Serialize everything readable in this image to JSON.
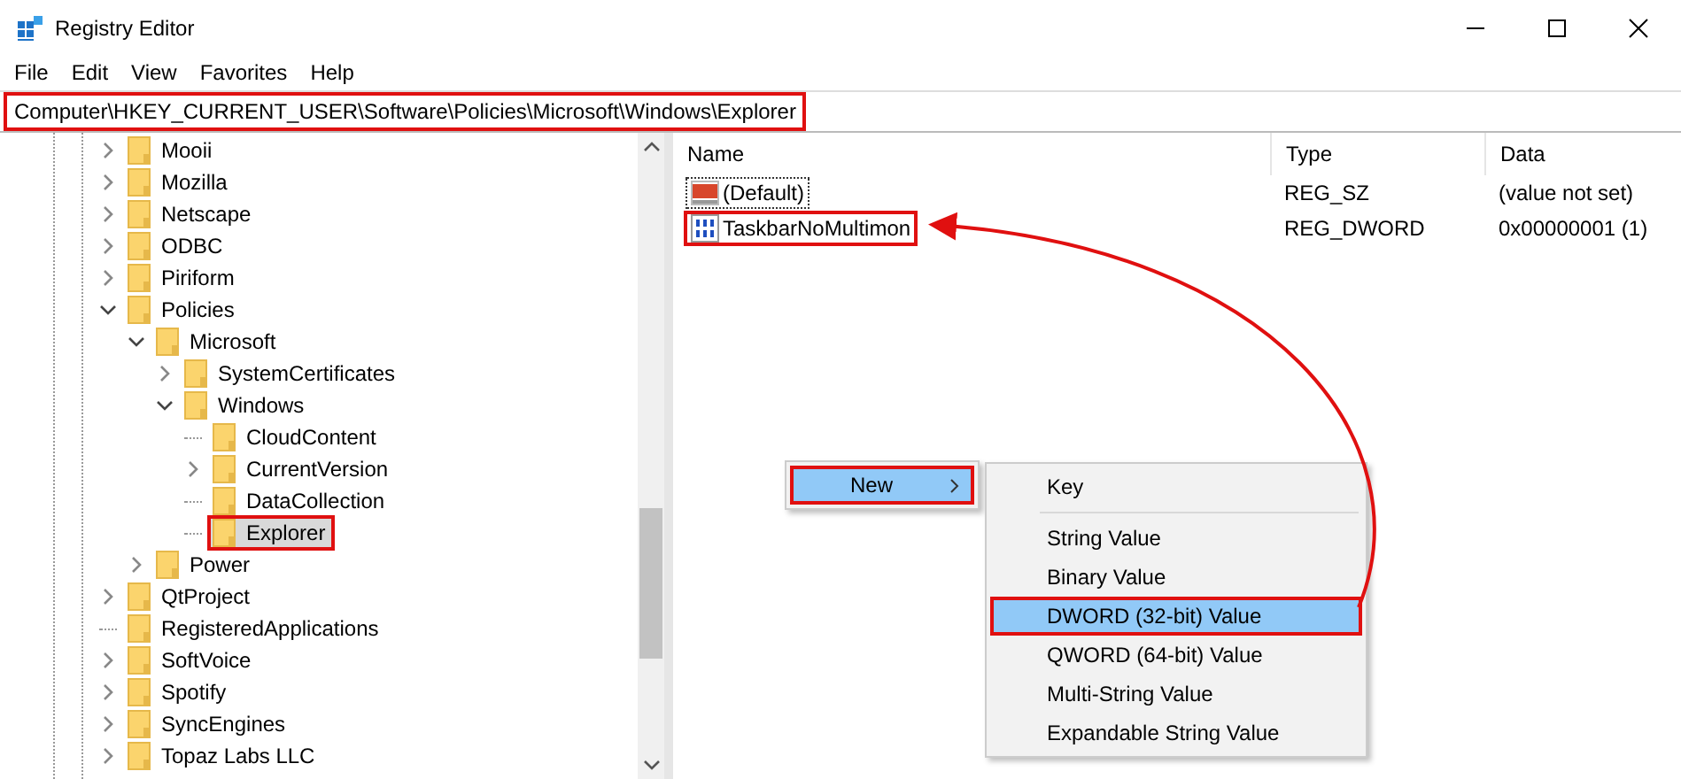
{
  "window": {
    "title": "Registry Editor"
  },
  "menu": [
    "File",
    "Edit",
    "View",
    "Favorites",
    "Help"
  ],
  "address_bar": {
    "value": "Computer\\HKEY_CURRENT_USER\\Software\\Policies\\Microsoft\\Windows\\Explorer",
    "highlighted": true
  },
  "tree": [
    {
      "label": "Mooii",
      "kind": "collapsed",
      "selected": false,
      "highlighted": false
    },
    {
      "label": "Mozilla",
      "kind": "collapsed",
      "selected": false,
      "highlighted": false
    },
    {
      "label": "Netscape",
      "kind": "collapsed",
      "selected": false,
      "highlighted": false
    },
    {
      "label": "ODBC",
      "kind": "collapsed",
      "selected": false,
      "highlighted": false
    },
    {
      "label": "Piriform",
      "kind": "collapsed",
      "selected": false,
      "highlighted": false
    },
    {
      "label": "Policies",
      "kind": "expanded",
      "selected": false,
      "highlighted": false,
      "children": [
        {
          "label": "Microsoft",
          "kind": "expanded",
          "selected": false,
          "highlighted": false,
          "children": [
            {
              "label": "SystemCertificates",
              "kind": "collapsed",
              "selected": false,
              "highlighted": false
            },
            {
              "label": "Windows",
              "kind": "expanded",
              "selected": false,
              "highlighted": false,
              "children": [
                {
                  "label": "CloudContent",
                  "kind": "leaf",
                  "selected": false,
                  "highlighted": false
                },
                {
                  "label": "CurrentVersion",
                  "kind": "collapsed",
                  "selected": false,
                  "highlighted": false
                },
                {
                  "label": "DataCollection",
                  "kind": "leaf",
                  "selected": false,
                  "highlighted": false
                },
                {
                  "label": "Explorer",
                  "kind": "leaf",
                  "selected": true,
                  "highlighted": true
                }
              ]
            }
          ]
        },
        {
          "label": "Power",
          "kind": "collapsed",
          "selected": false,
          "highlighted": false
        }
      ]
    },
    {
      "label": "QtProject",
      "kind": "collapsed",
      "selected": false,
      "highlighted": false
    },
    {
      "label": "RegisteredApplications",
      "kind": "leaf",
      "selected": false,
      "highlighted": false
    },
    {
      "label": "SoftVoice",
      "kind": "collapsed",
      "selected": false,
      "highlighted": false
    },
    {
      "label": "Spotify",
      "kind": "collapsed",
      "selected": false,
      "highlighted": false
    },
    {
      "label": "SyncEngines",
      "kind": "collapsed",
      "selected": false,
      "highlighted": false
    },
    {
      "label": "Topaz Labs LLC",
      "kind": "collapsed",
      "selected": false,
      "highlighted": false
    }
  ],
  "values_table": {
    "columns": [
      "Name",
      "Type",
      "Data"
    ],
    "rows": [
      {
        "kind": "string",
        "name": "(Default)",
        "type": "REG_SZ",
        "data": "(value not set)",
        "focused": true,
        "highlighted": false
      },
      {
        "kind": "number",
        "name": "TaskbarNoMultimon",
        "type": "REG_DWORD",
        "data": "0x00000001 (1)",
        "focused": false,
        "highlighted": true
      }
    ]
  },
  "context_menu": {
    "items": [
      {
        "label": "New",
        "selected": true,
        "highlighted": true
      }
    ]
  },
  "submenu": {
    "items": [
      {
        "kind": "item",
        "label": "Key",
        "selected": false,
        "highlighted": false
      },
      {
        "kind": "separator"
      },
      {
        "kind": "item",
        "label": "String Value",
        "selected": false,
        "highlighted": false
      },
      {
        "kind": "item",
        "label": "Binary Value",
        "selected": false,
        "highlighted": false
      },
      {
        "kind": "item",
        "label": "DWORD (32-bit) Value",
        "selected": true,
        "highlighted": true
      },
      {
        "kind": "item",
        "label": "QWORD (64-bit) Value",
        "selected": false,
        "highlighted": false
      },
      {
        "kind": "item",
        "label": "Multi-String Value",
        "selected": false,
        "highlighted": false
      },
      {
        "kind": "item",
        "label": "Expandable String Value",
        "selected": false,
        "highlighted": false
      }
    ]
  }
}
